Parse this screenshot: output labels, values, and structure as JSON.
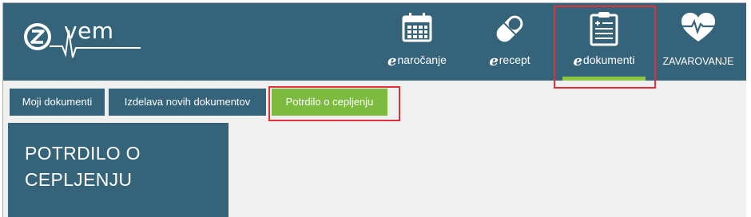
{
  "app": {
    "logo_text": "vem",
    "logo_mark": "z"
  },
  "nav": {
    "items": [
      {
        "prefix": "e",
        "label": "naročanje",
        "icon": "calendar-icon"
      },
      {
        "prefix": "e",
        "label": "recept",
        "icon": "pill-icon"
      },
      {
        "prefix": "e",
        "label": "dokumenti",
        "icon": "clipboard-icon",
        "active": true
      },
      {
        "prefix": "",
        "label": "ZAVAROVANJE",
        "icon": "heart-pulse-icon"
      }
    ]
  },
  "tabs": [
    {
      "label": "Moji dokumenti"
    },
    {
      "label": "Izdelava novih dokumentov"
    },
    {
      "label": "Potrdilo o cepljenju",
      "active": true
    }
  ],
  "panel": {
    "title": "POTRDILO O CEPLJENJU"
  },
  "colors": {
    "primary": "#35647a",
    "accent": "#7cbb40",
    "highlight": "#e0313a",
    "background": "#f0f0f0"
  }
}
